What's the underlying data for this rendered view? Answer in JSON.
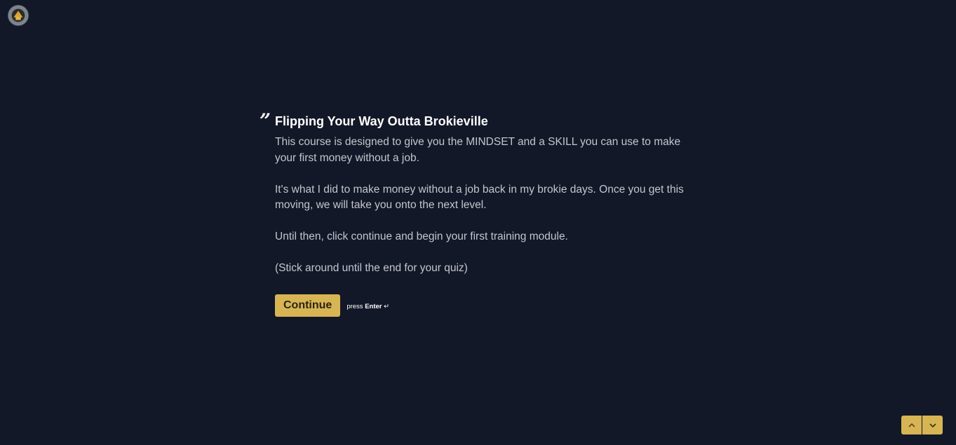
{
  "header": {
    "logo_icon": "brand-logo-icon"
  },
  "question": {
    "quote_mark": "”",
    "title": "Flipping Your Way Outta Brokieville",
    "paragraphs": [
      "This course is designed to give you the MINDSET and a SKILL you can use to make your first money without a job.",
      "It's what I did to make money without a job back in my brokie days. Once you get this moving, we will take you onto the next level.",
      "Until then, click continue and begin your first training module.",
      "(Stick around until the end for your quiz)"
    ]
  },
  "actions": {
    "continue_label": "Continue",
    "hint_prefix": "press",
    "hint_key": "Enter",
    "hint_icon": "↵"
  },
  "navigation": {
    "up_icon": "chevron-up-icon",
    "down_icon": "chevron-down-icon"
  },
  "colors": {
    "background": "#131828",
    "accent": "#d8b554",
    "title": "#ffffff",
    "body_text": "#c3c6cf"
  }
}
